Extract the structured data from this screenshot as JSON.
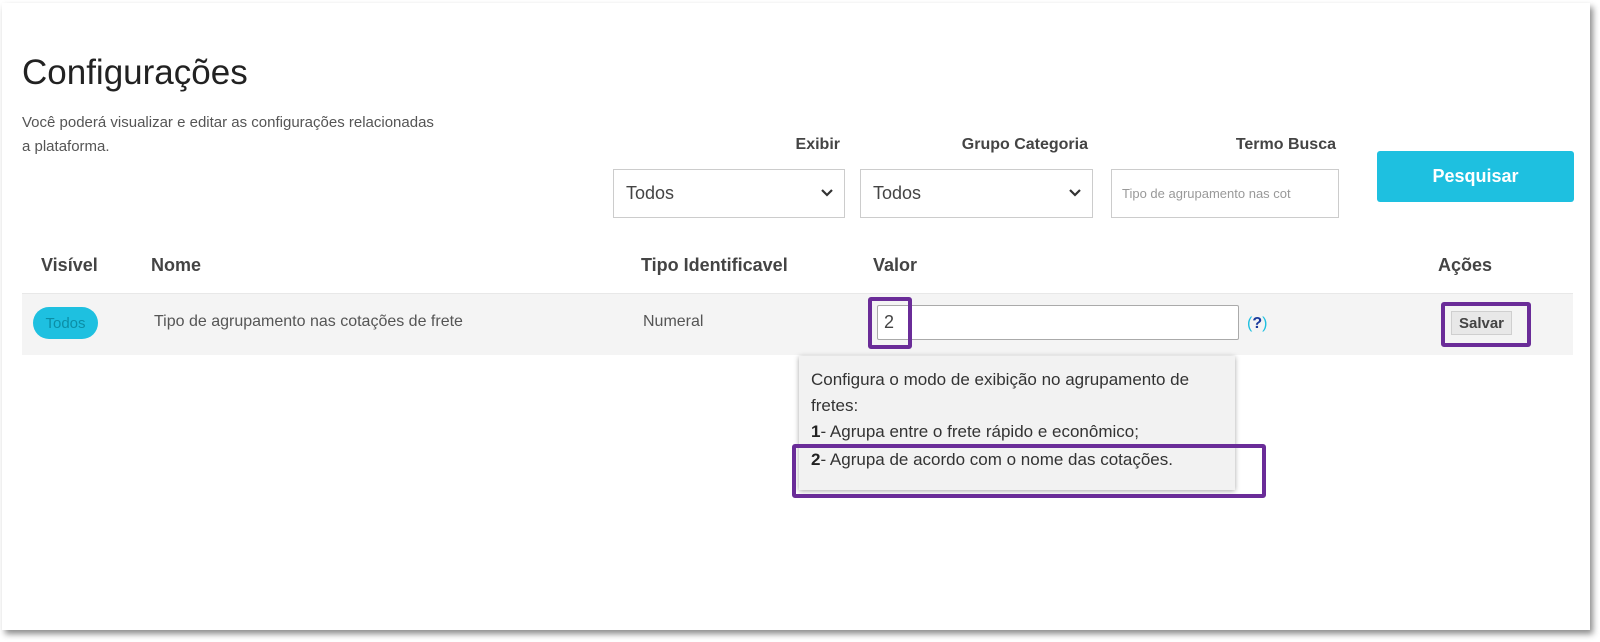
{
  "page": {
    "title": "Configurações",
    "subtitle": "Você poderá visualizar e editar as configurações relacionadas a plataforma."
  },
  "filters": {
    "exibir": {
      "label": "Exibir",
      "value": "Todos"
    },
    "grupo_categoria": {
      "label": "Grupo Categoria",
      "value": "Todos"
    },
    "termo_busca": {
      "label": "Termo Busca",
      "value": "Tipo de agrupamento nas cot"
    },
    "search_button": "Pesquisar"
  },
  "table": {
    "headers": {
      "visivel": "Visível",
      "nome": "Nome",
      "tipo": "Tipo Identificavel",
      "valor": "Valor",
      "acoes": "Ações"
    },
    "rows": [
      {
        "visivel": "Todos",
        "nome": "Tipo de agrupamento nas cotações de frete",
        "tipo": "Numeral",
        "valor": "2",
        "help": "?",
        "action": "Salvar"
      }
    ]
  },
  "tooltip": {
    "intro_1": "Configura o modo de exibição no agrupamento de",
    "intro_2": "fretes:",
    "opt1_num": "1",
    "opt1_text": "- Agrupa entre o frete rápido e econômico;",
    "opt2_num": "2",
    "opt2_text": "- Agrupa de acordo com o nome das cotações."
  },
  "colors": {
    "accent": "#1ec0e0",
    "highlight": "#6a2c98"
  }
}
